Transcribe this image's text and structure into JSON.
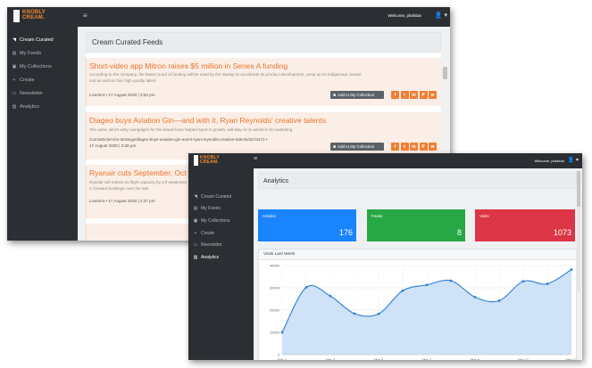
{
  "brand": {
    "line1": "KNOBLY",
    "line2": "CREAM."
  },
  "welcome": "Welcome, phebbar",
  "menu_glyph": "≡",
  "user_glyph": "👤 ▾",
  "colors": {
    "sidebar": "#2b2f33",
    "accent": "#e9742d",
    "articles": "#1a84ff",
    "feeds": "#28a745",
    "visits": "#dc3545",
    "chart_fill": "#cfe2f7",
    "chart_line": "#2f7ed8"
  },
  "sidebar": {
    "items": [
      {
        "label": "Cream Curated",
        "icon": "rss-icon",
        "glyph": "◥"
      },
      {
        "label": "My Feeds",
        "icon": "feed-icon",
        "glyph": "▤"
      },
      {
        "label": "My Collections",
        "icon": "collection-icon",
        "glyph": "▣"
      },
      {
        "label": "Create",
        "icon": "plus-icon",
        "glyph": "+"
      },
      {
        "label": "Newsletter",
        "icon": "newsletter-icon",
        "glyph": "▭"
      },
      {
        "label": "Analytics",
        "icon": "analytics-icon",
        "glyph": "▥"
      }
    ]
  },
  "feeds_page": {
    "title": "Cream Curated Feeds",
    "collect_label": "Add to My Collection",
    "social": [
      "f",
      "t",
      "in",
      "P",
      "w"
    ],
    "cards": [
      {
        "title": "Short-video app Mitron raises $5 million in Series A funding",
        "body": "According to the company, the latest round of funding will be used by the startup to accelerate its product development, ramp up its indigenous creator tool as well as hire high quality talent",
        "meta": "Livemint • 17 August 2020 | 3:52 pm"
      },
      {
        "title": "Diageo buys Aviation Gin—and with it, Ryan Reynolds' creative talents",
        "body": "The actor, who's witty campaigns for the brand have helped spurt is growth, will stay on to assist in its marketing.",
        "url": "Com/article/cmo-strategy/diageo-buys-aviation-gin-and-it-ryan-reynolds-creative-talents/2274171 • 17 August 2020 | 3:39 pm",
        "meta": ""
      },
      {
        "title": "Ryanair cuts September, Oct",
        "body": "Ryanair will reduce its flight capacity by a fi weakness in forward bookings over the last",
        "meta": "Livemint • 17 August 2020 | 2:37 pm"
      }
    ]
  },
  "analytics_page": {
    "title": "Analytics",
    "stats": [
      {
        "label": "Articles",
        "value": "176"
      },
      {
        "label": "Feeds",
        "value": "8"
      },
      {
        "label": "Visits",
        "value": "1073"
      }
    ],
    "chart_title": "Visits Last Week"
  },
  "chart_data": {
    "type": "area",
    "title": "Visits Last Week",
    "x": [
      "Mar 1",
      "Mar 2",
      "Mar 3",
      "Mar 4",
      "Mar 5",
      "Mar 6",
      "Mar 7",
      "Mar 8",
      "Mar 9",
      "Mar 10",
      "Mar 11",
      "Mar 12",
      "Mar 13"
    ],
    "x_tick_labels": [
      "Mar 1",
      "Mar 3",
      "Mar 5",
      "Mar 7",
      "Mar 9",
      "Mar 11",
      "Mar 13"
    ],
    "series": [
      {
        "values": [
          10000,
          30200,
          26300,
          18400,
          18300,
          28700,
          31300,
          33200,
          25800,
          24200,
          32900,
          31800,
          38200
        ]
      }
    ],
    "ylim": [
      0,
      40000
    ],
    "y_ticks": [
      0,
      10000,
      20000,
      30000,
      40000
    ],
    "grid": true,
    "xlabel": "",
    "ylabel": ""
  }
}
